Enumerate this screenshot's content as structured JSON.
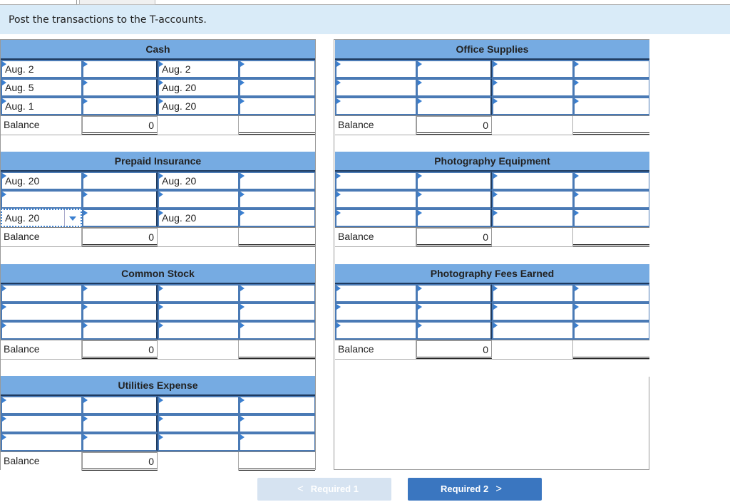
{
  "instructions": "Post the transactions to the T-accounts.",
  "accounts": [
    {
      "title": "Cash",
      "rows": [
        {
          "debit_label": "Aug. 2",
          "debit_amount": "",
          "credit_label": "Aug. 2",
          "credit_amount": ""
        },
        {
          "debit_label": "Aug. 5",
          "debit_amount": "",
          "credit_label": "Aug. 20",
          "credit_amount": ""
        },
        {
          "debit_label": "Aug. 1",
          "debit_amount": "",
          "credit_label": "Aug. 20",
          "credit_amount": ""
        }
      ],
      "balance_label": "Balance",
      "balance_value": "0"
    },
    {
      "title": "Office Supplies",
      "rows": [
        {
          "debit_label": "",
          "debit_amount": "",
          "credit_label": "",
          "credit_amount": ""
        },
        {
          "debit_label": "",
          "debit_amount": "",
          "credit_label": "",
          "credit_amount": ""
        },
        {
          "debit_label": "",
          "debit_amount": "",
          "credit_label": "",
          "credit_amount": ""
        }
      ],
      "balance_label": "Balance",
      "balance_value": "0"
    },
    {
      "title": "Prepaid Insurance",
      "rows": [
        {
          "debit_label": "Aug. 20",
          "debit_amount": "",
          "credit_label": "Aug. 20",
          "credit_amount": ""
        },
        {
          "debit_label": "",
          "debit_amount": "",
          "credit_label": "",
          "credit_amount": ""
        },
        {
          "debit_label": "Aug. 20",
          "debit_amount": "",
          "credit_label": "Aug. 20",
          "credit_amount": ""
        }
      ],
      "balance_label": "Balance",
      "balance_value": "0"
    },
    {
      "title": "Photography Equipment",
      "rows": [
        {
          "debit_label": "",
          "debit_amount": "",
          "credit_label": "",
          "credit_amount": ""
        },
        {
          "debit_label": "",
          "debit_amount": "",
          "credit_label": "",
          "credit_amount": ""
        },
        {
          "debit_label": "",
          "debit_amount": "",
          "credit_label": "",
          "credit_amount": ""
        }
      ],
      "balance_label": "Balance",
      "balance_value": "0"
    },
    {
      "title": "Common Stock",
      "rows": [
        {
          "debit_label": "",
          "debit_amount": "",
          "credit_label": "",
          "credit_amount": ""
        },
        {
          "debit_label": "",
          "debit_amount": "",
          "credit_label": "",
          "credit_amount": ""
        },
        {
          "debit_label": "",
          "debit_amount": "",
          "credit_label": "",
          "credit_amount": ""
        }
      ],
      "balance_label": "Balance",
      "balance_value": "0"
    },
    {
      "title": "Photography Fees Earned",
      "rows": [
        {
          "debit_label": "",
          "debit_amount": "",
          "credit_label": "",
          "credit_amount": ""
        },
        {
          "debit_label": "",
          "debit_amount": "",
          "credit_label": "",
          "credit_amount": ""
        },
        {
          "debit_label": "",
          "debit_amount": "",
          "credit_label": "",
          "credit_amount": ""
        }
      ],
      "balance_label": "Balance",
      "balance_value": "0"
    },
    {
      "title": "Utilities Expense",
      "rows": [
        {
          "debit_label": "",
          "debit_amount": "",
          "credit_label": "",
          "credit_amount": ""
        },
        {
          "debit_label": "",
          "debit_amount": "",
          "credit_label": "",
          "credit_amount": ""
        },
        {
          "debit_label": "",
          "debit_amount": "",
          "credit_label": "",
          "credit_amount": ""
        }
      ],
      "balance_label": "Balance",
      "balance_value": "0"
    }
  ],
  "nav": {
    "prev_label": "Required 1",
    "next_label": "Required 2",
    "prev_chevron": "<",
    "next_chevron": ">"
  }
}
